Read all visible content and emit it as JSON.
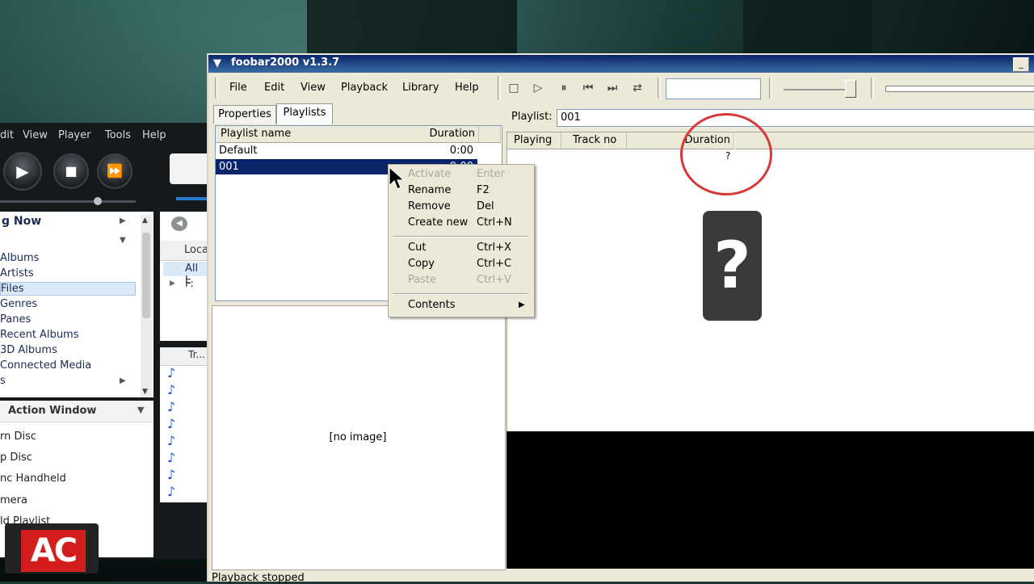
{
  "background_player": {
    "menu": [
      "dit",
      "View",
      "Player",
      "Tools",
      "Help"
    ],
    "tree_title": "g Now",
    "tree_items": [
      "Albums",
      "Artists",
      "Files",
      "Genres",
      "Panes",
      "Recent Albums",
      "3D Albums",
      "Connected Media",
      "s"
    ],
    "side_items": [
      "Loca",
      "All L",
      "F:"
    ],
    "column": "Tr...",
    "action_window_title": "Action Window",
    "actions": [
      "rn Disc",
      "p Disc",
      "nc Handheld",
      "mera",
      "ld Playlist"
    ]
  },
  "logo": {
    "text": "AC",
    "color": "#d41e1e"
  },
  "window": {
    "title": "foobar2000 v1.3.7",
    "menu": [
      "File",
      "Edit",
      "View",
      "Playback",
      "Library",
      "Help"
    ]
  },
  "tabs": [
    "Properties",
    "Playlists"
  ],
  "playlist_manager": {
    "columns": [
      "Playlist name",
      "Duration"
    ],
    "rows": [
      {
        "name": "Default",
        "duration": "0:00"
      },
      {
        "name": "001",
        "duration": "0:00"
      }
    ]
  },
  "album_art": {
    "placeholder": "[no image]"
  },
  "playlist_bar": {
    "label": "Playlist:",
    "value": "001"
  },
  "track_columns": [
    "Playing",
    "Track no",
    "Duration"
  ],
  "track_duration_value": "?",
  "annotation": {
    "glyph": "?",
    "circle_color": "#d83838"
  },
  "context_menu": {
    "items": [
      {
        "label": "Activate",
        "key": "Enter",
        "disabled": true
      },
      {
        "label": "Rename",
        "key": "F2"
      },
      {
        "label": "Remove",
        "key": "Del"
      },
      {
        "label": "Create new",
        "key": "Ctrl+N"
      },
      {
        "label": "Cut",
        "key": "Ctrl+X"
      },
      {
        "label": "Copy",
        "key": "Ctrl+C"
      },
      {
        "label": "Paste",
        "key": "Ctrl+V",
        "disabled": true
      },
      {
        "label": "Contents"
      }
    ]
  },
  "status_text": "Playback stopped",
  "colors": {
    "selection": "#0a246a",
    "window_face": "#ece9d8",
    "titlebar": "#0a246a"
  }
}
